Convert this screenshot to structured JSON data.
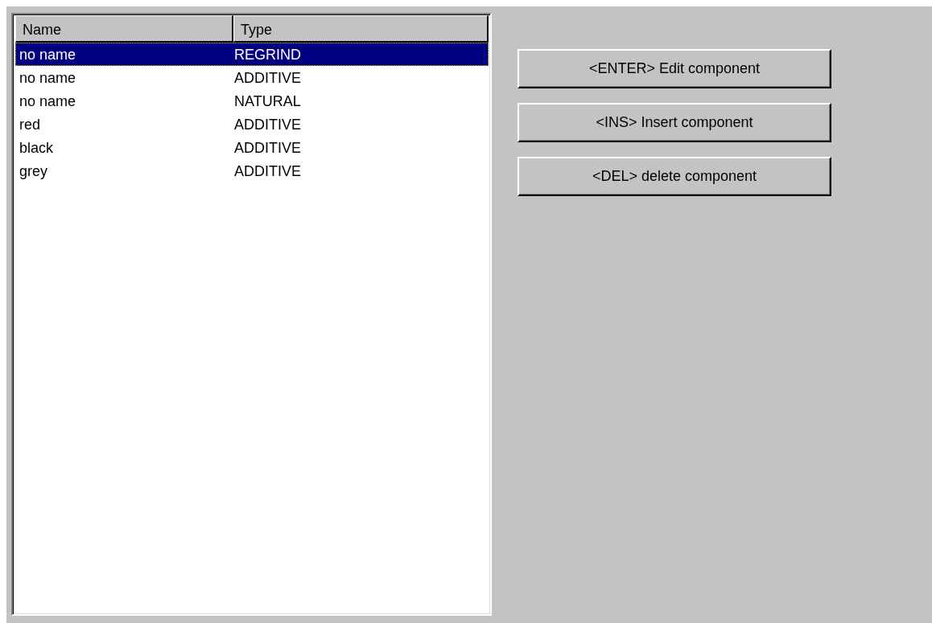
{
  "table": {
    "columns": [
      "Name",
      "Type"
    ],
    "rows": [
      {
        "name": "no name",
        "type": "REGRIND",
        "selected": true
      },
      {
        "name": "no name",
        "type": "ADDITIVE",
        "selected": false
      },
      {
        "name": "no name",
        "type": "NATURAL",
        "selected": false
      },
      {
        "name": "red",
        "type": "ADDITIVE",
        "selected": false
      },
      {
        "name": "black",
        "type": "ADDITIVE",
        "selected": false
      },
      {
        "name": "grey",
        "type": "ADDITIVE",
        "selected": false
      }
    ]
  },
  "buttons": [
    "<ENTER> Edit component",
    "<INS> Insert component",
    "<DEL> delete component"
  ]
}
